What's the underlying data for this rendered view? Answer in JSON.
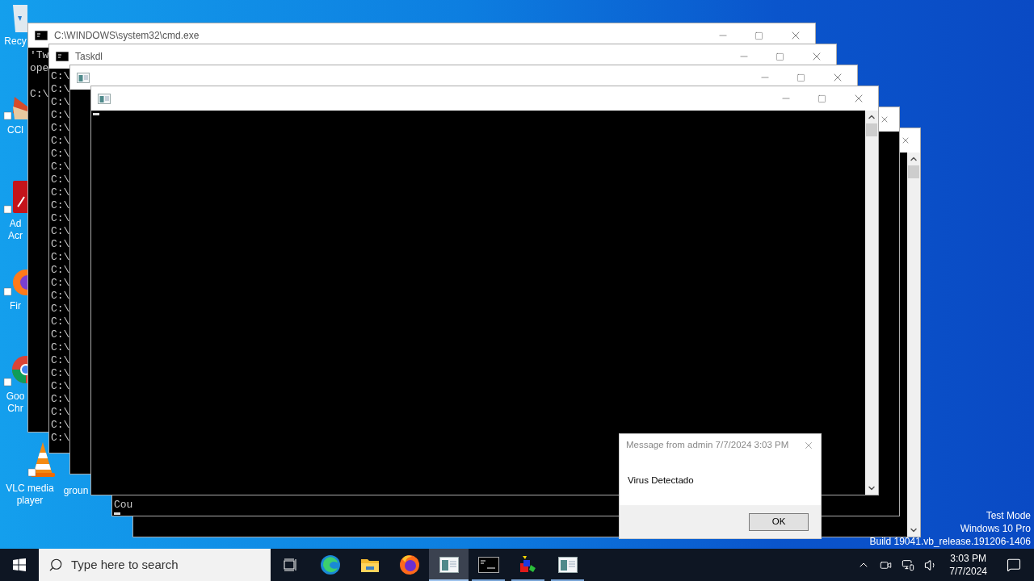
{
  "desktop_icons": [
    {
      "label": "Recy",
      "kind": "recycle-bin"
    },
    {
      "label": "CCl",
      "kind": "shortcut-broom"
    },
    {
      "label": "Ad\nAcr",
      "kind": "shortcut-pdf"
    },
    {
      "label": "Fir",
      "kind": "shortcut-firefox"
    },
    {
      "label": "Goo\nChr",
      "kind": "shortcut-chrome"
    },
    {
      "label": "VLC media\nplayer",
      "kind": "shortcut-cone"
    },
    {
      "label": "groun"
    }
  ],
  "windows": [
    {
      "kind": "console",
      "title": "C:\\WINDOWS\\system32\\cmd.exe",
      "blocks": [
        [
          "'Tw",
          "ope"
        ],
        [
          "C:\\"
        ]
      ]
    },
    {
      "kind": "console",
      "title": "Taskdl",
      "blocks": [
        [
          "C:\\",
          "C:\\",
          "C:\\",
          "C:\\",
          "C:\\",
          "C:\\",
          "C:\\",
          "C:\\",
          "C:\\",
          "C:\\",
          "C:\\",
          "C:\\",
          "C:\\",
          "C:\\",
          "C:\\",
          "C:\\",
          "C:\\",
          "C:\\",
          "C:\\",
          "C:\\",
          "C:\\",
          "C:\\",
          "C:\\",
          "C:\\",
          "C:\\",
          "C:\\",
          "C:\\",
          "C:\\",
          "C:\\"
        ]
      ]
    },
    {
      "kind": "app"
    },
    {
      "kind": "app",
      "cursor": true
    }
  ],
  "back_windows": [
    {
      "blocks": [
        [
          "Cou"
        ]
      ],
      "cursor": true,
      "scrollbar": false
    },
    {
      "scrollbar": true
    }
  ],
  "message_box": {
    "title": "Message from admin 7/7/2024 3:03 PM",
    "text": "Virus Detectado",
    "button": "OK"
  },
  "system_text": [
    "Test Mode",
    "Windows 10 Pro",
    "Build 19041.vb_release.191206-1406"
  ],
  "taskbar": {
    "search_placeholder": "Type here to search",
    "apps": [
      {
        "kind": "task-view",
        "running": false,
        "selected": false
      },
      {
        "kind": "edge",
        "running": false,
        "selected": false
      },
      {
        "kind": "folder",
        "running": false,
        "selected": false
      },
      {
        "kind": "firefox",
        "running": false,
        "selected": false
      },
      {
        "kind": "app-window",
        "running": true,
        "selected": true
      },
      {
        "kind": "console",
        "running": true,
        "selected": false
      },
      {
        "kind": "shapes",
        "running": true,
        "selected": false
      },
      {
        "kind": "app-window",
        "running": true,
        "selected": false
      }
    ],
    "time": "3:03 PM",
    "date": "7/7/2024"
  }
}
